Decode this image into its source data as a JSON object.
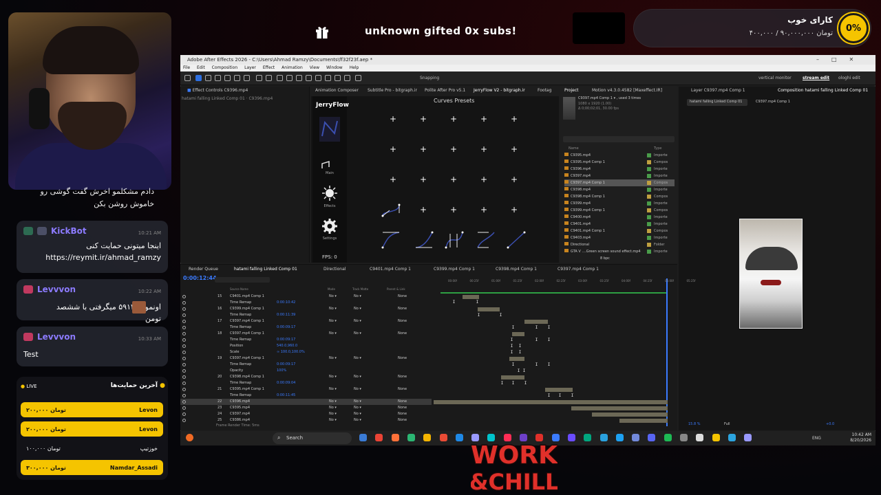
{
  "top": {
    "gift_text": "unknown gifted 0x subs!",
    "goal_title": "کارای خوب",
    "goal_amounts": "۴۰۰,۰۰۰ / ۹۰,۰۰۰,۰۰۰ تومان",
    "goal_percent": "0%"
  },
  "chat": {
    "msg0": "دادم مشکلمو اخرش گفت گوشی رو خاموش روشن بکن",
    "messages": [
      {
        "name": "KickBot",
        "time": "10:21 AM",
        "text": "اینجا میتونی حمایت کنی https://reymit.ir/ahmad_ramzy"
      },
      {
        "name": "Levvvon",
        "time": "10:22 AM",
        "text": "اونموقع ۵۹۱۲ میگرفتی با ششصد تومن"
      },
      {
        "name": "Levvvon",
        "time": "10:33 AM",
        "text": "Test"
      }
    ]
  },
  "supporters": {
    "live": "LIVE",
    "title": "آخرین حمایت‌ها",
    "rows": [
      {
        "name": "Levon",
        "amount": "۲۰۰,۰۰۰ تومان"
      },
      {
        "name": "Levon",
        "amount": "۲۰۰,۰۰۰ تومان"
      },
      {
        "name": "خوزتیپ",
        "amount": "۱۰۰,۰۰۰ تومان"
      },
      {
        "name": "Namdar_Assadi",
        "amount": "۳۰۰,۰۰۰ تومان"
      }
    ]
  },
  "ae": {
    "title": "Adobe After Effects 2026 - C:\\Users\\Ahmad Ramzy\\Documents\\ff32f23f.aep *",
    "menu": [
      "File",
      "Edit",
      "Composition",
      "Layer",
      "Effect",
      "Animation",
      "View",
      "Window",
      "Help"
    ],
    "snapping": "Snapping",
    "workspaces": [
      "vertical monitor",
      "stream edit",
      "ologhi edit"
    ],
    "effect_controls_tab": "Effect Controls C9396.mp4",
    "effect_controls_path": "hatami falling Linked Comp 01 · C9396.mp4",
    "top_tabs": [
      "Animation Composer",
      "Subtitle Pro - bitgraph.ir",
      "Polite After Pro v5.1",
      "JerryFlow V2 - bitgraph.ir",
      "Footag"
    ],
    "project_tab": "Project",
    "motion_tab": "Motion v4.3.0.4582 [Maxeffect.IR]",
    "layer_tab": "Layer C9397.mp4 Comp 1",
    "comp_tab": "Composition hatami falling Linked Comp 01",
    "viewer_breadcrumbs": [
      "hatami falling Linked Comp 01",
      "C9397.mp4 Comp 1"
    ],
    "jerry": {
      "logo": "JerryFlow",
      "curves_title": "Curves Presets",
      "main": "Main",
      "effects": "Effects",
      "settings": "Settings",
      "fps": "FPS: 0"
    },
    "project": {
      "info_name": "C9397.mp4 Comp 1 ▾ , used 3 times",
      "info_res": "1080 x 1920 (1.00)",
      "info_dur": "Δ 0;00;02;01, 30.00 fps",
      "col_name": "Name",
      "col_type": "Type",
      "bpc": "8 bpc",
      "items": [
        {
          "name": "C9395.mp4",
          "type": "Importe",
          "color": "#4a9c4a"
        },
        {
          "name": "C9395.mp4 Comp 1",
          "type": "Compos",
          "color": "#c0a040"
        },
        {
          "name": "C9396.mp4",
          "type": "Importe",
          "color": "#4a9c4a"
        },
        {
          "name": "C9397.mp4",
          "type": "Importe",
          "color": "#4a9c4a"
        },
        {
          "name": "C9397.mp4 Comp 1",
          "type": "Compos",
          "color": "#c0a040"
        },
        {
          "name": "C9398.mp4",
          "type": "Importe",
          "color": "#4a9c4a"
        },
        {
          "name": "C9398.mp4 Comp 1",
          "type": "Compos",
          "color": "#c0a040"
        },
        {
          "name": "C9399.mp4",
          "type": "Importe",
          "color": "#4a9c4a"
        },
        {
          "name": "C9399.mp4 Comp 1",
          "type": "Compos",
          "color": "#c0a040"
        },
        {
          "name": "C9400.mp4",
          "type": "Importe",
          "color": "#4a9c4a"
        },
        {
          "name": "C9401.mp4",
          "type": "Importe",
          "color": "#4a9c4a"
        },
        {
          "name": "C9401.mp4 Comp 1",
          "type": "Compos",
          "color": "#c0a040"
        },
        {
          "name": "C9403.mp4",
          "type": "Importe",
          "color": "#4a9c4a"
        },
        {
          "name": "Directional",
          "type": "Folder",
          "color": "#c0a040"
        },
        {
          "name": "GTA V ....Green screen sound effect.mp4",
          "type": "Importe",
          "color": "#4a9c4a"
        }
      ]
    },
    "timeline": {
      "tabs": [
        "Render Queue",
        "hatami falling Linked Comp 01",
        "Directional",
        "C9401.mp4 Comp 1",
        "C9399.mp4 Comp 1",
        "C9398.mp4 Comp 1",
        "C9397.mp4 Comp 1"
      ],
      "timecode": "0:00:12:44",
      "col_source": "Source Name",
      "col_mode": "Mode",
      "col_track": "Track Matte",
      "col_parent": "Parent & Link",
      "ruler": [
        "00:00f",
        "00:25f",
        "01:00f",
        "01:25f",
        "02:00f",
        "02:25f",
        "03:00f",
        "03:25f",
        "04:00f",
        "04:25f",
        "05:00f",
        "05:25f"
      ],
      "rows": [
        {
          "num": "15",
          "name": "C9401.mp4 Comp 1",
          "val": "",
          "mode": "No ▾",
          "parent": "None"
        },
        {
          "num": "",
          "name": "Time Remap",
          "val": "0:00:10:42",
          "mode": "",
          "parent": ""
        },
        {
          "num": "16",
          "name": "C9399.mp4 Comp 1",
          "val": "",
          "mode": "No ▾",
          "parent": "None"
        },
        {
          "num": "",
          "name": "Time Remap",
          "val": "0:00:11:39",
          "mode": "",
          "parent": ""
        },
        {
          "num": "17",
          "name": "C9397.mp4 Comp 1",
          "val": "",
          "mode": "No ▾",
          "parent": "None"
        },
        {
          "num": "",
          "name": "Time Remap",
          "val": "0:00:09:17",
          "mode": "",
          "parent": ""
        },
        {
          "num": "18",
          "name": "C9397.mp4 Comp 1",
          "val": "",
          "mode": "No ▾",
          "parent": "None"
        },
        {
          "num": "",
          "name": "Time Remap",
          "val": "0:00:09:17",
          "mode": "",
          "parent": ""
        },
        {
          "num": "",
          "name": "Position",
          "val": "540.0,960.0",
          "mode": "",
          "parent": ""
        },
        {
          "num": "",
          "name": "Scale",
          "val": "∞ 100.0,100.0%",
          "mode": "",
          "parent": ""
        },
        {
          "num": "19",
          "name": "C9397.mp4 Comp 1",
          "val": "",
          "mode": "No ▾",
          "parent": "None"
        },
        {
          "num": "",
          "name": "Time Remap",
          "val": "0:00:09:17",
          "mode": "",
          "parent": ""
        },
        {
          "num": "",
          "name": "Opacity",
          "val": "100%",
          "mode": "",
          "parent": ""
        },
        {
          "num": "20",
          "name": "C9398.mp4 Comp 1",
          "val": "",
          "mode": "No ▾",
          "parent": "None"
        },
        {
          "num": "",
          "name": "Time Remap",
          "val": "0:00:09:04",
          "mode": "",
          "parent": ""
        },
        {
          "num": "21",
          "name": "C9395.mp4 Comp 1",
          "val": "",
          "mode": "No ▾",
          "parent": "None"
        },
        {
          "num": "",
          "name": "Time Remap",
          "val": "0:00:11:45",
          "mode": "",
          "parent": ""
        },
        {
          "num": "22",
          "name": "C9396.mp4",
          "val": "",
          "mode": "No ▾",
          "parent": "None"
        },
        {
          "num": "23",
          "name": "C9395.mp4",
          "val": "",
          "mode": "No ▾",
          "parent": "None"
        },
        {
          "num": "24",
          "name": "C9397.mp4",
          "val": "",
          "mode": "No ▾",
          "parent": "None"
        },
        {
          "num": "25",
          "name": "C9386.mp4",
          "val": "",
          "mode": "No ▾",
          "parent": "None"
        }
      ],
      "footer": "Frame Render Time: 5ms"
    },
    "viewer_zoom": "15.8 %",
    "viewer_quality": "Full",
    "viewer_exposure": "+0.0"
  },
  "taskbar": {
    "search": "Search",
    "lang": "ENG",
    "time": "10:42 AM",
    "date": "8/20/2026"
  },
  "logo": {
    "line1": "WORK",
    "line2": "&CHILL"
  }
}
